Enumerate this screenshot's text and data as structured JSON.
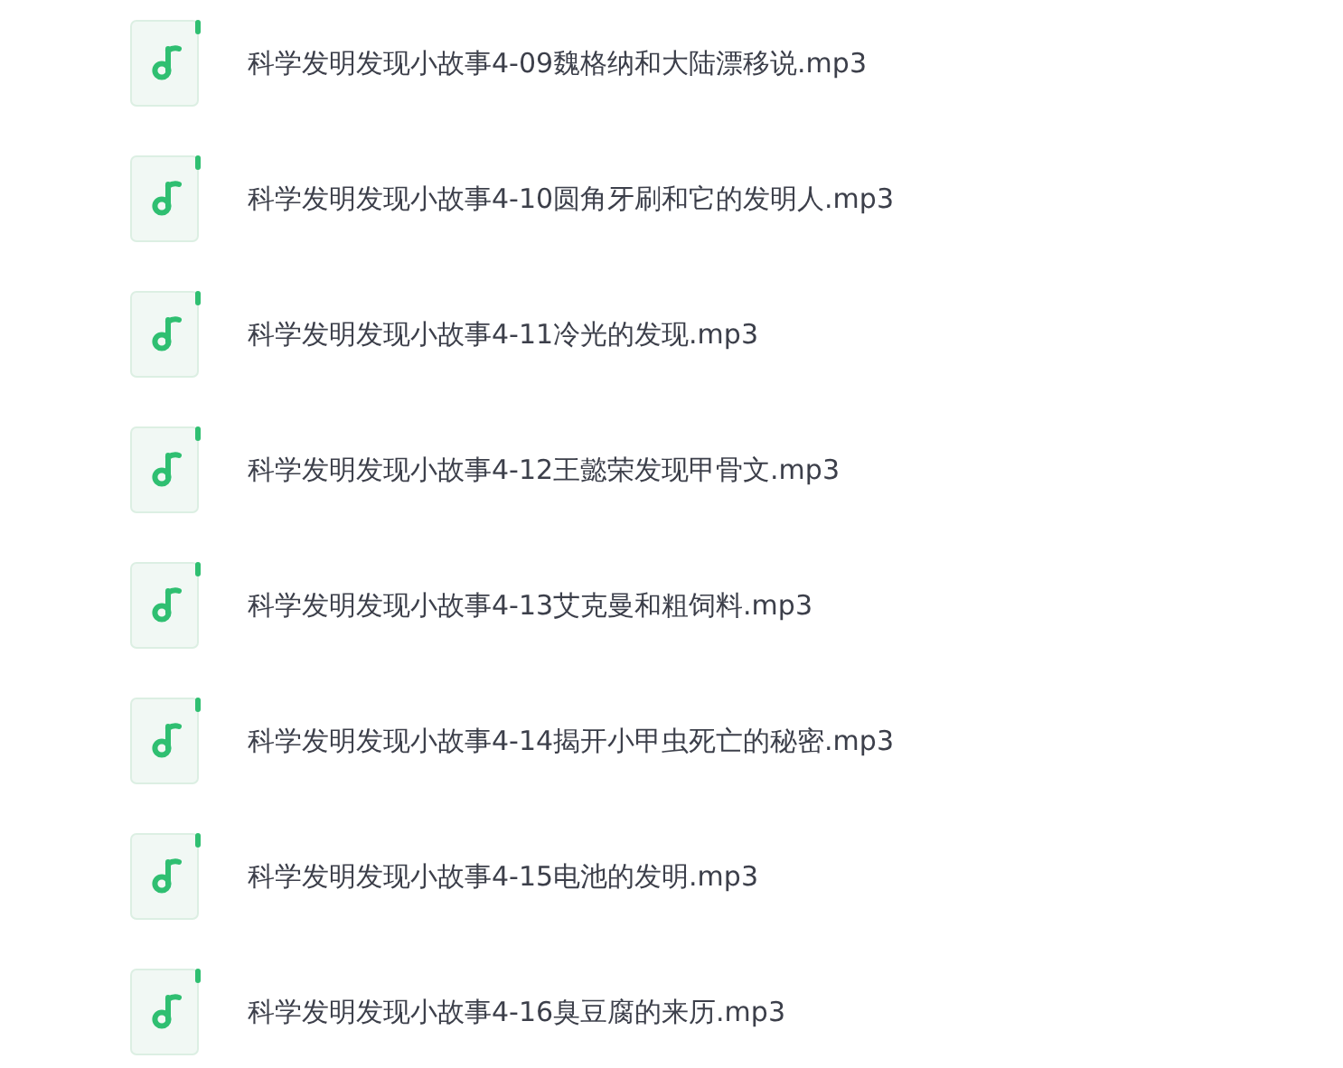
{
  "files": [
    {
      "name": "科学发明发现小故事4-09魏格纳和大陆漂移说.mp3"
    },
    {
      "name": "科学发明发现小故事4-10圆角牙刷和它的发明人.mp3"
    },
    {
      "name": "科学发明发现小故事4-11冷光的发现.mp3"
    },
    {
      "name": "科学发明发现小故事4-12王懿荣发现甲骨文.mp3"
    },
    {
      "name": "科学发明发现小故事4-13艾克曼和粗饲料.mp3"
    },
    {
      "name": "科学发明发现小故事4-14揭开小甲虫死亡的秘密.mp3"
    },
    {
      "name": "科学发明发现小故事4-15电池的发明.mp3"
    },
    {
      "name": "科学发明发现小故事4-16臭豆腐的来历.mp3"
    }
  ]
}
